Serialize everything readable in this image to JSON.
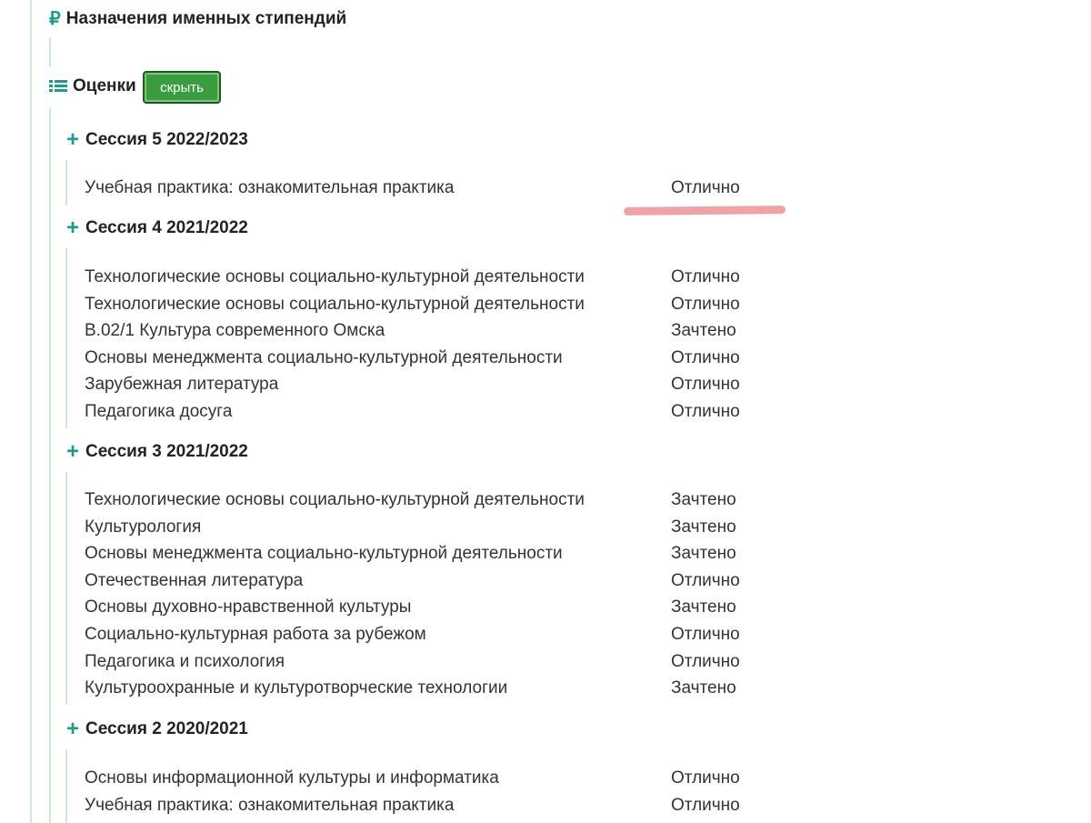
{
  "scholarships": {
    "icon": "ruble-icon",
    "title": "Назначения именных стипендий"
  },
  "grades": {
    "icon": "list-icon",
    "title": "Оценки",
    "hide_button": "скрыть"
  },
  "colors": {
    "accent": "#1f9a8e",
    "button": "#3b9b3f",
    "guide_line": "#cfe8d2",
    "highlight": "#ec9a9a"
  },
  "sessions": [
    {
      "title": "Сессия 5 2022/2023",
      "items": [
        {
          "subject": "Учебная практика: ознакомительная практика",
          "grade": "Отлично"
        }
      ]
    },
    {
      "title": "Сессия 4 2021/2022",
      "items": [
        {
          "subject": "Технологические основы социально-культурной деятельности",
          "grade": "Отлично"
        },
        {
          "subject": "Технологические основы социально-культурной деятельности",
          "grade": "Отлично"
        },
        {
          "subject": "В.02/1 Культура современного Омска",
          "grade": "Зачтено"
        },
        {
          "subject": "Основы менеджмента социально-культурной деятельности",
          "grade": "Отлично"
        },
        {
          "subject": "Зарубежная литература",
          "grade": "Отлично"
        },
        {
          "subject": "Педагогика досуга",
          "grade": "Отлично"
        }
      ]
    },
    {
      "title": "Сессия 3 2021/2022",
      "items": [
        {
          "subject": "Технологические основы социально-культурной деятельности",
          "grade": "Зачтено"
        },
        {
          "subject": "Культурология",
          "grade": "Зачтено"
        },
        {
          "subject": "Основы менеджмента социально-культурной деятельности",
          "grade": "Зачтено"
        },
        {
          "subject": "Отечественная литература",
          "grade": "Отлично"
        },
        {
          "subject": "Основы духовно-нравственной культуры",
          "grade": "Зачтено"
        },
        {
          "subject": "Социально-культурная работа за рубежом",
          "grade": "Отлично"
        },
        {
          "subject": "Педагогика и психология",
          "grade": "Отлично"
        },
        {
          "subject": "Культуроохранные и культуротворческие технологии",
          "grade": "Зачтено"
        }
      ]
    },
    {
      "title": "Сессия 2 2020/2021",
      "items": [
        {
          "subject": "Основы информационной культуры и информатика",
          "grade": "Отлично"
        },
        {
          "subject": "Учебная практика: ознакомительная практика",
          "grade": "Отлично"
        }
      ]
    }
  ]
}
